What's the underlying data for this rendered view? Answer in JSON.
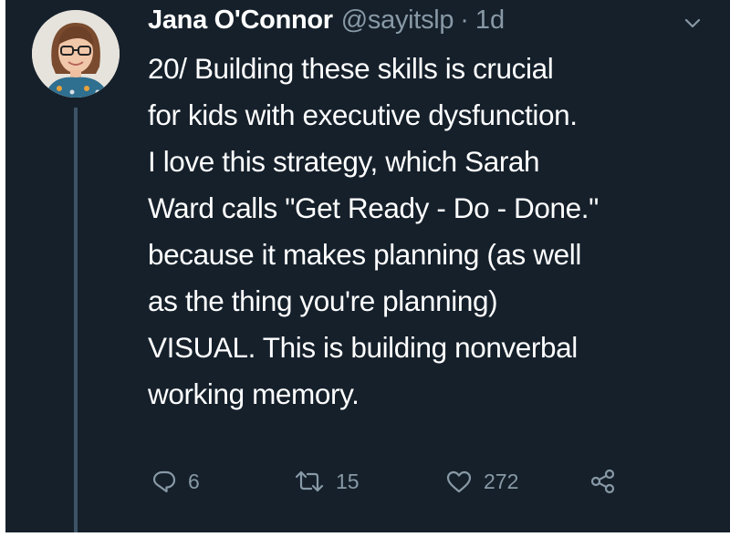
{
  "tweet": {
    "author_name": "Jana O'Connor",
    "handle": "@sayitslp",
    "separator": "·",
    "timestamp": "1d",
    "body_lines": [
      "20/ Building these skills is crucial",
      "for kids with executive dysfunction.",
      "I love this strategy, which Sarah",
      "Ward calls \"Get Ready - Do - Done.\"",
      "because it makes planning (as well",
      "as the thing you're planning)",
      "VISUAL. This is building nonverbal",
      "working memory."
    ],
    "actions": {
      "reply_count": "6",
      "retweet_count": "15",
      "like_count": "272"
    },
    "icons": {
      "reply": "reply-icon",
      "retweet": "retweet-icon",
      "like": "heart-icon",
      "share": "share-icon",
      "menu": "chevron-down-icon"
    }
  },
  "colors": {
    "background": "#15202b",
    "primary_text": "#ffffff",
    "secondary_text": "#8899a6",
    "thread_line": "#3d5466"
  }
}
